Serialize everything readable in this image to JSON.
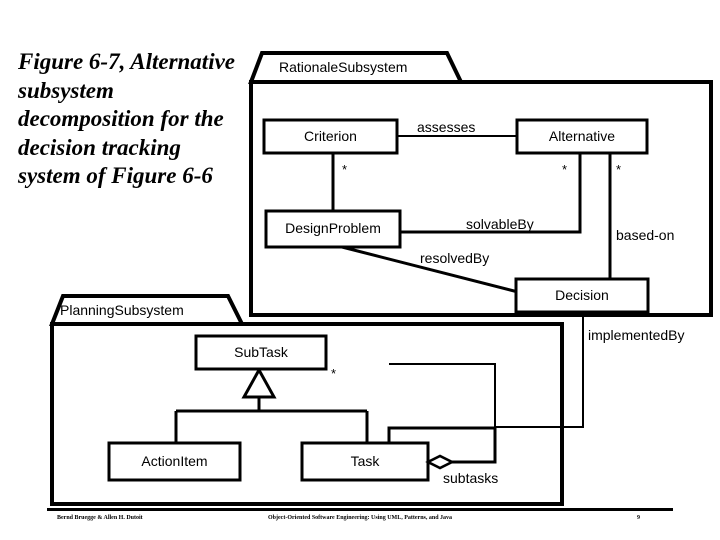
{
  "caption": {
    "text": "Figure 6-7, Alternative subsystem decomposition for the decision tracking system of Figure 6-6"
  },
  "packages": [
    {
      "id": "rationale",
      "name": "RationaleSubsystem"
    },
    {
      "id": "planning",
      "name": "PlanningSubsystem"
    }
  ],
  "classes": [
    {
      "id": "criterion",
      "name": "Criterion",
      "package": "RationaleSubsystem"
    },
    {
      "id": "alternative",
      "name": "Alternative",
      "package": "RationaleSubsystem"
    },
    {
      "id": "designproblem",
      "name": "DesignProblem",
      "package": "RationaleSubsystem"
    },
    {
      "id": "decision",
      "name": "Decision",
      "package": "RationaleSubsystem"
    },
    {
      "id": "subtask",
      "name": "SubTask",
      "package": "PlanningSubsystem"
    },
    {
      "id": "actionitem",
      "name": "ActionItem",
      "package": "PlanningSubsystem"
    },
    {
      "id": "task",
      "name": "Task",
      "package": "PlanningSubsystem"
    }
  ],
  "associations": [
    {
      "id": "assesses",
      "label": "assesses",
      "from": "Criterion",
      "to": "Alternative"
    },
    {
      "id": "solvableby",
      "label": "solvableBy",
      "from": "DesignProblem",
      "to": "Alternative"
    },
    {
      "id": "basedon",
      "label": "based-on",
      "from": "Alternative",
      "to": "Decision"
    },
    {
      "id": "resolvedby",
      "label": "resolvedBy",
      "from": "DesignProblem",
      "to": "Decision"
    },
    {
      "id": "implementedby",
      "label": "implementedBy",
      "from": "Decision",
      "to": "SubTask"
    },
    {
      "id": "subtasks",
      "label": "subtasks",
      "from": "Task",
      "to": "Task"
    }
  ],
  "multiplicities": [
    {
      "id": "mult-criterion-down",
      "value": "*"
    },
    {
      "id": "mult-alternative-left",
      "value": "*"
    },
    {
      "id": "mult-alternative-right",
      "value": "*"
    },
    {
      "id": "mult-subtask",
      "value": "*"
    }
  ],
  "generalization": {
    "parent": "SubTask",
    "children": [
      "ActionItem",
      "Task"
    ]
  },
  "footer": {
    "authors": "Bernd Bruegge & Allen H. Dutoit",
    "book": "Object-Oriented Software Engineering: Using UML, Patterns, and Java",
    "page": "9"
  },
  "colors": {
    "line": "#000000",
    "fill": "#ffffff",
    "background": "#ffffff"
  }
}
